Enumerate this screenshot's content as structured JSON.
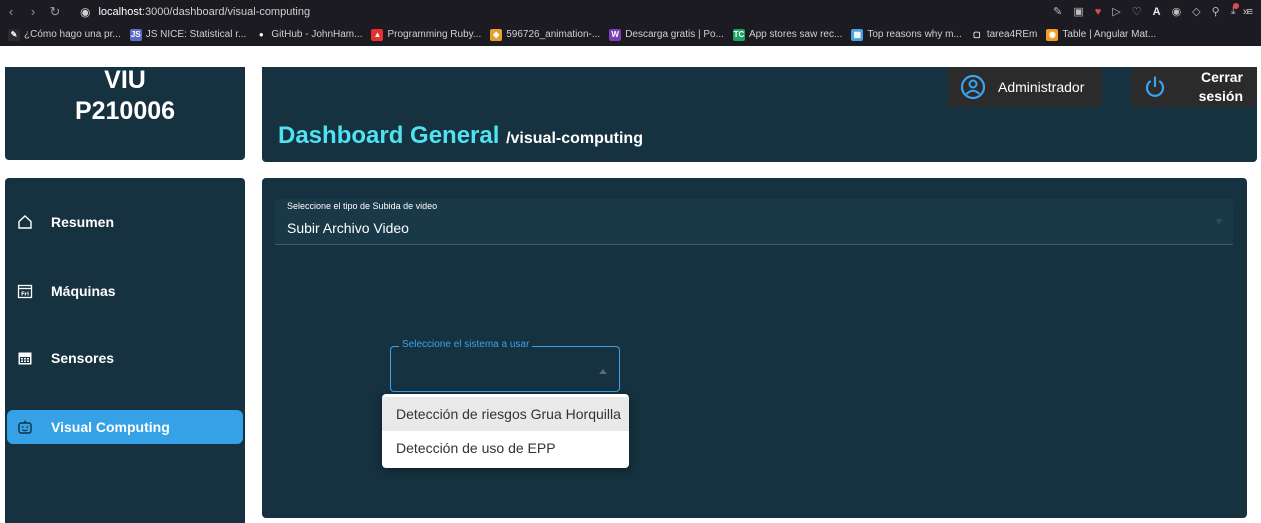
{
  "browser": {
    "url_host": "localhost",
    "url_rest": ":3000/dashboard/visual-computing",
    "bookmarks": [
      {
        "label": "¿Cómo hago una pr...",
        "color": "#2b2b2b",
        "glyph": "✎"
      },
      {
        "label": "JS NICE: Statistical r...",
        "color": "#5a6ec8",
        "glyph": "JS"
      },
      {
        "label": "GitHub - JohnHam...",
        "color": "#1c1b22",
        "glyph": "●"
      },
      {
        "label": "Programming Ruby...",
        "color": "#e5322d",
        "glyph": "▲"
      },
      {
        "label": "596726_animation-...",
        "color": "#e5a12d",
        "glyph": "◆"
      },
      {
        "label": "Descarga gratis | Po...",
        "color": "#7b3fb8",
        "glyph": "W"
      },
      {
        "label": "App stores saw rec...",
        "color": "#19a35f",
        "glyph": "TC"
      },
      {
        "label": "Top reasons why m...",
        "color": "#4aa0e0",
        "glyph": "▦"
      },
      {
        "label": "tarea4REm",
        "color": "#1c1b22",
        "glyph": "▢"
      },
      {
        "label": "Table | Angular Mat...",
        "color": "#f29b28",
        "glyph": "◉"
      }
    ],
    "ext_letter": "A"
  },
  "brand": {
    "line1": "VIU",
    "line2": "P210006"
  },
  "header": {
    "title": "Dashboard General",
    "path": "/visual-computing",
    "user_label": "Administrador",
    "logout_line1": "Cerrar",
    "logout_line2": "sesión"
  },
  "sidebar": {
    "items": [
      {
        "label": "Resumen",
        "icon": "home-icon"
      },
      {
        "label": "Máquinas",
        "icon": "calendar-fri-icon"
      },
      {
        "label": "Sensores",
        "icon": "calendar-grid-icon"
      },
      {
        "label": "Visual Computing",
        "icon": "robot-face-icon",
        "active": true
      }
    ]
  },
  "content": {
    "upload_type_label": "Seleccione el tipo de Subida de video",
    "upload_type_value": "Subir Archivo Video",
    "system_label": "Seleccione el sistema a usar",
    "system_options": [
      "Detección de riesgos Grua Horquilla",
      "Detección de uso de EPP"
    ]
  },
  "colors": {
    "panel": "#16313f",
    "accent": "#35a2e8",
    "title": "#4fe3f2"
  }
}
